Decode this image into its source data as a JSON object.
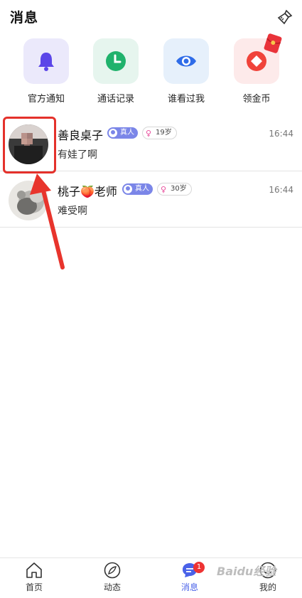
{
  "header": {
    "title": "消息"
  },
  "quick_actions": [
    {
      "label": "官方通知",
      "icon": "bell-icon",
      "bg": "#ebe9fb",
      "color": "#5b46e8"
    },
    {
      "label": "通话记录",
      "icon": "clock-icon",
      "bg": "#e6f5ee",
      "color": "#20b26c"
    },
    {
      "label": "谁看过我",
      "icon": "eye-icon",
      "bg": "#e6f0fb",
      "color": "#2f6ce8"
    },
    {
      "label": "领金币",
      "icon": "coin-icon",
      "bg": "#fdeaea",
      "color": "#f0433a"
    }
  ],
  "conversations": [
    {
      "name": "善良桌子",
      "real_badge": "真人",
      "age": "19岁",
      "time": "16:44",
      "message": "有娃了啊"
    },
    {
      "name": "桃子🍑老师",
      "real_badge": "真人",
      "age": "30岁",
      "time": "16:44",
      "message": "难受啊"
    }
  ],
  "tabs": [
    {
      "label": "首页",
      "icon": "home-icon"
    },
    {
      "label": "动态",
      "icon": "compass-icon"
    },
    {
      "label": "消息",
      "icon": "chat-icon",
      "badge": "1"
    },
    {
      "label": "我的",
      "icon": "profile-icon"
    }
  ],
  "watermark": "Baidu经验"
}
